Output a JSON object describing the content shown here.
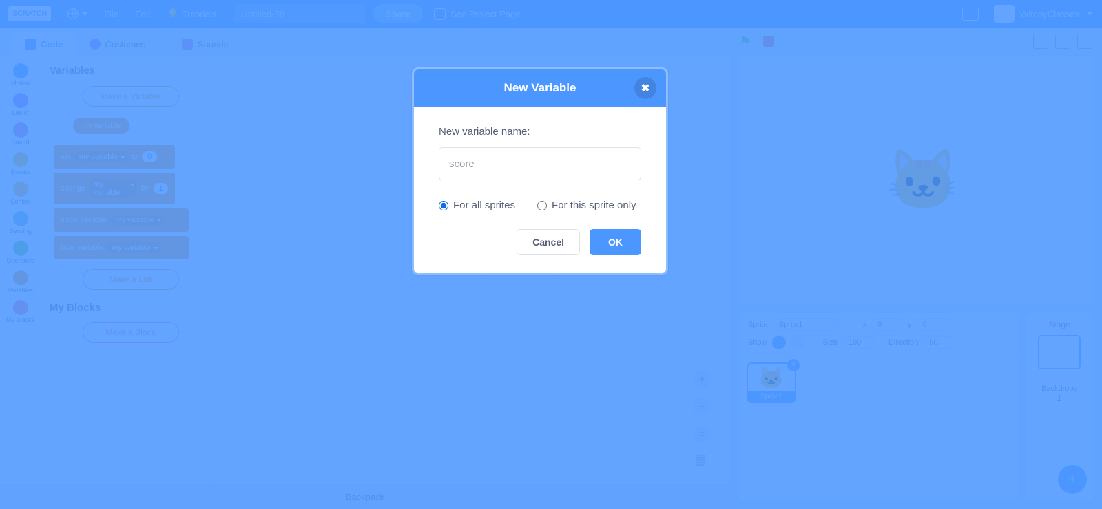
{
  "menubar": {
    "logo": "SCRATCH",
    "language_icon": "globe-icon",
    "file": "File",
    "edit": "Edit",
    "tutorials": "Tutorials",
    "tutorials_icon": "lightbulb-icon",
    "project_title": "Untitled-38",
    "share": "Share",
    "project_page": "See Project Page",
    "project_page_icon": "folder-open-icon",
    "my_stuff_icon": "folder-icon",
    "username": "WitopyClasses",
    "avatar": "user-avatar"
  },
  "tabs": [
    {
      "label": "Code",
      "icon": "code-icon",
      "active": true
    },
    {
      "label": "Costumes",
      "icon": "costume-brush-icon",
      "active": false
    },
    {
      "label": "Sounds",
      "icon": "sound-speaker-icon",
      "active": false
    }
  ],
  "categories": [
    {
      "label": "Motion",
      "color": "#4c97ff"
    },
    {
      "label": "Looks",
      "color": "#9966ff"
    },
    {
      "label": "Sound",
      "color": "#cf63cf"
    },
    {
      "label": "Events",
      "color": "#ffbf00"
    },
    {
      "label": "Control",
      "color": "#ffab19"
    },
    {
      "label": "Sensing",
      "color": "#5cb1d6"
    },
    {
      "label": "Operators",
      "color": "#59c059"
    },
    {
      "label": "Variables",
      "color": "#ff8c1a"
    },
    {
      "label": "My Blocks",
      "color": "#ff6680"
    }
  ],
  "palette": {
    "heading": "Variables",
    "make_variable": "Make a Variable",
    "variable_chip": "my variable",
    "blocks": [
      {
        "prefix": "set",
        "var": "my variable",
        "mid": "to",
        "value": "0"
      },
      {
        "prefix": "change",
        "var": "my variable",
        "mid": "by",
        "value": "1"
      },
      {
        "prefix": "show variable",
        "var": "my variable",
        "mid": "",
        "value": ""
      },
      {
        "prefix": "hide variable",
        "var": "my variable",
        "mid": "",
        "value": ""
      }
    ],
    "make_list": "Make a List",
    "myblocks_heading": "My Blocks",
    "make_block": "Make a Block"
  },
  "canvas": {
    "zoom_in": "+",
    "zoom_out": "−",
    "zoom_reset": "=",
    "delete_icon": "trash-icon"
  },
  "backpack": {
    "label": "Backpack"
  },
  "stage": {
    "green_flag": "⚑",
    "stop": "stop-icon",
    "small_stage": "small-stage-icon",
    "large_stage": "large-stage-icon",
    "fullscreen": "fullscreen-icon",
    "sprite_glyph": "🐱"
  },
  "sprite_panel": {
    "sprite_label": "Sprite",
    "sprite_name": "Sprite1",
    "x_label": "x",
    "x_value": "0",
    "y_label": "y",
    "y_value": "0",
    "show_label": "Show",
    "size_label": "Size",
    "size_value": "100",
    "direction_label": "Direction",
    "direction_value": "90",
    "card_name": "Sprite1",
    "delete_icon": "trash-icon",
    "add_sprite": "+"
  },
  "stage_panel": {
    "title": "Stage",
    "backdrops_label": "Backdrops",
    "backdrops_count": "1",
    "add_backdrop": "+"
  },
  "modal": {
    "title": "New Variable",
    "close_icon": "✖",
    "field_label": "New variable name:",
    "input_value": "",
    "input_placeholder": "score",
    "radio_all": "For all sprites",
    "radio_this": "For this sprite only",
    "selected_scope": "all",
    "cancel": "Cancel",
    "ok": "OK",
    "accent_color": "#4c97ff"
  }
}
